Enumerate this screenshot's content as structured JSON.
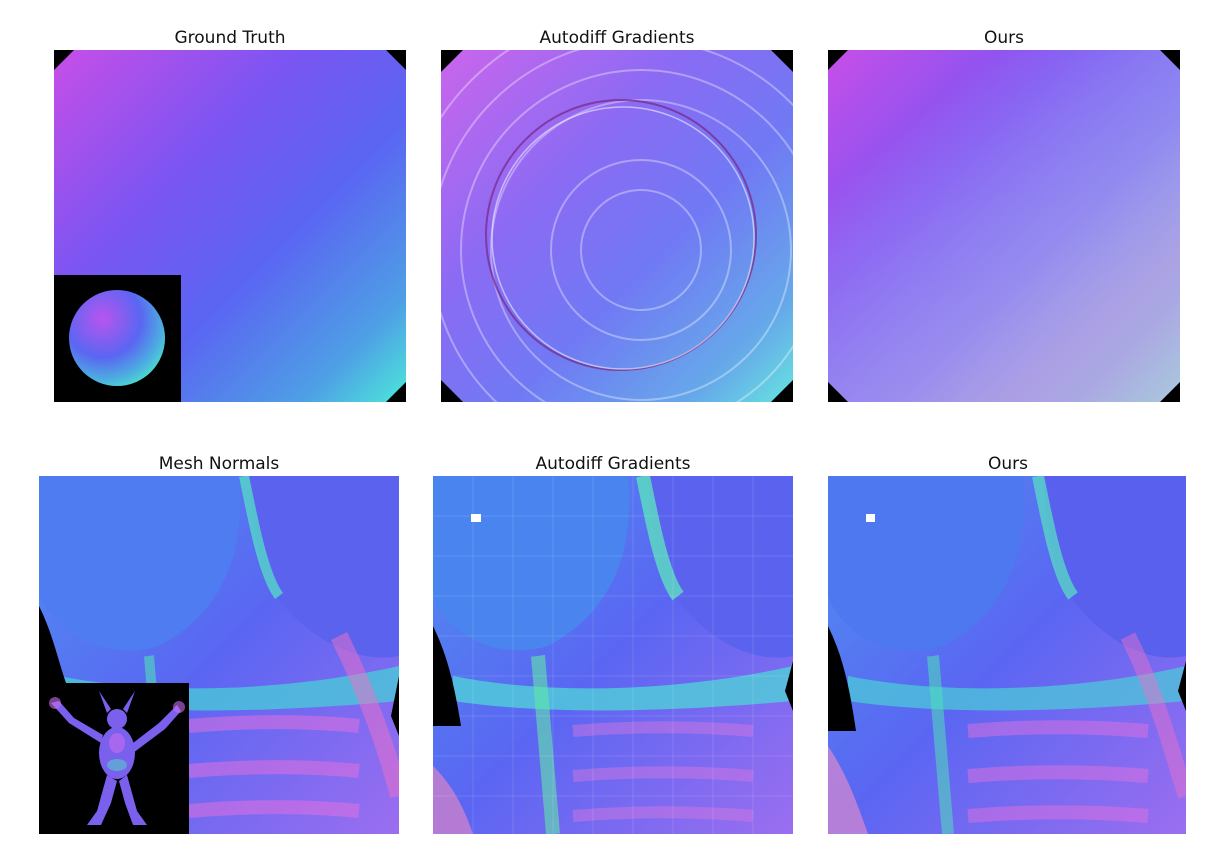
{
  "rows": [
    {
      "titles": [
        "Ground Truth",
        "Autodiff Gradients",
        "Ours"
      ]
    },
    {
      "titles": [
        "Mesh Normals",
        "Autodiff Gradients",
        "Ours"
      ]
    }
  ],
  "colors": {
    "normal_map_magenta": "#c84ee8",
    "normal_map_blue": "#4f63f2",
    "normal_map_cyan": "#4ce8d8",
    "normal_map_pink": "#f07ad8",
    "background": "#000000",
    "marker": "#ffffff"
  },
  "panels": {
    "ground_truth": {
      "icon": "sphere-normal-map",
      "inset": "sphere-normal-inset"
    },
    "autodiff_top": {
      "icon": "sphere-normal-map-ringing-artifacts"
    },
    "ours_top": {
      "icon": "sphere-normal-map-smooth"
    },
    "mesh_normals": {
      "icon": "armadillo-torso-normal-map",
      "inset": "armadillo-full-body-inset"
    },
    "autodiff_bottom": {
      "icon": "armadillo-torso-normal-map-blocky",
      "marker": "white-square-marker"
    },
    "ours_bottom": {
      "icon": "armadillo-torso-normal-map-smooth",
      "marker": "white-square-marker"
    }
  }
}
